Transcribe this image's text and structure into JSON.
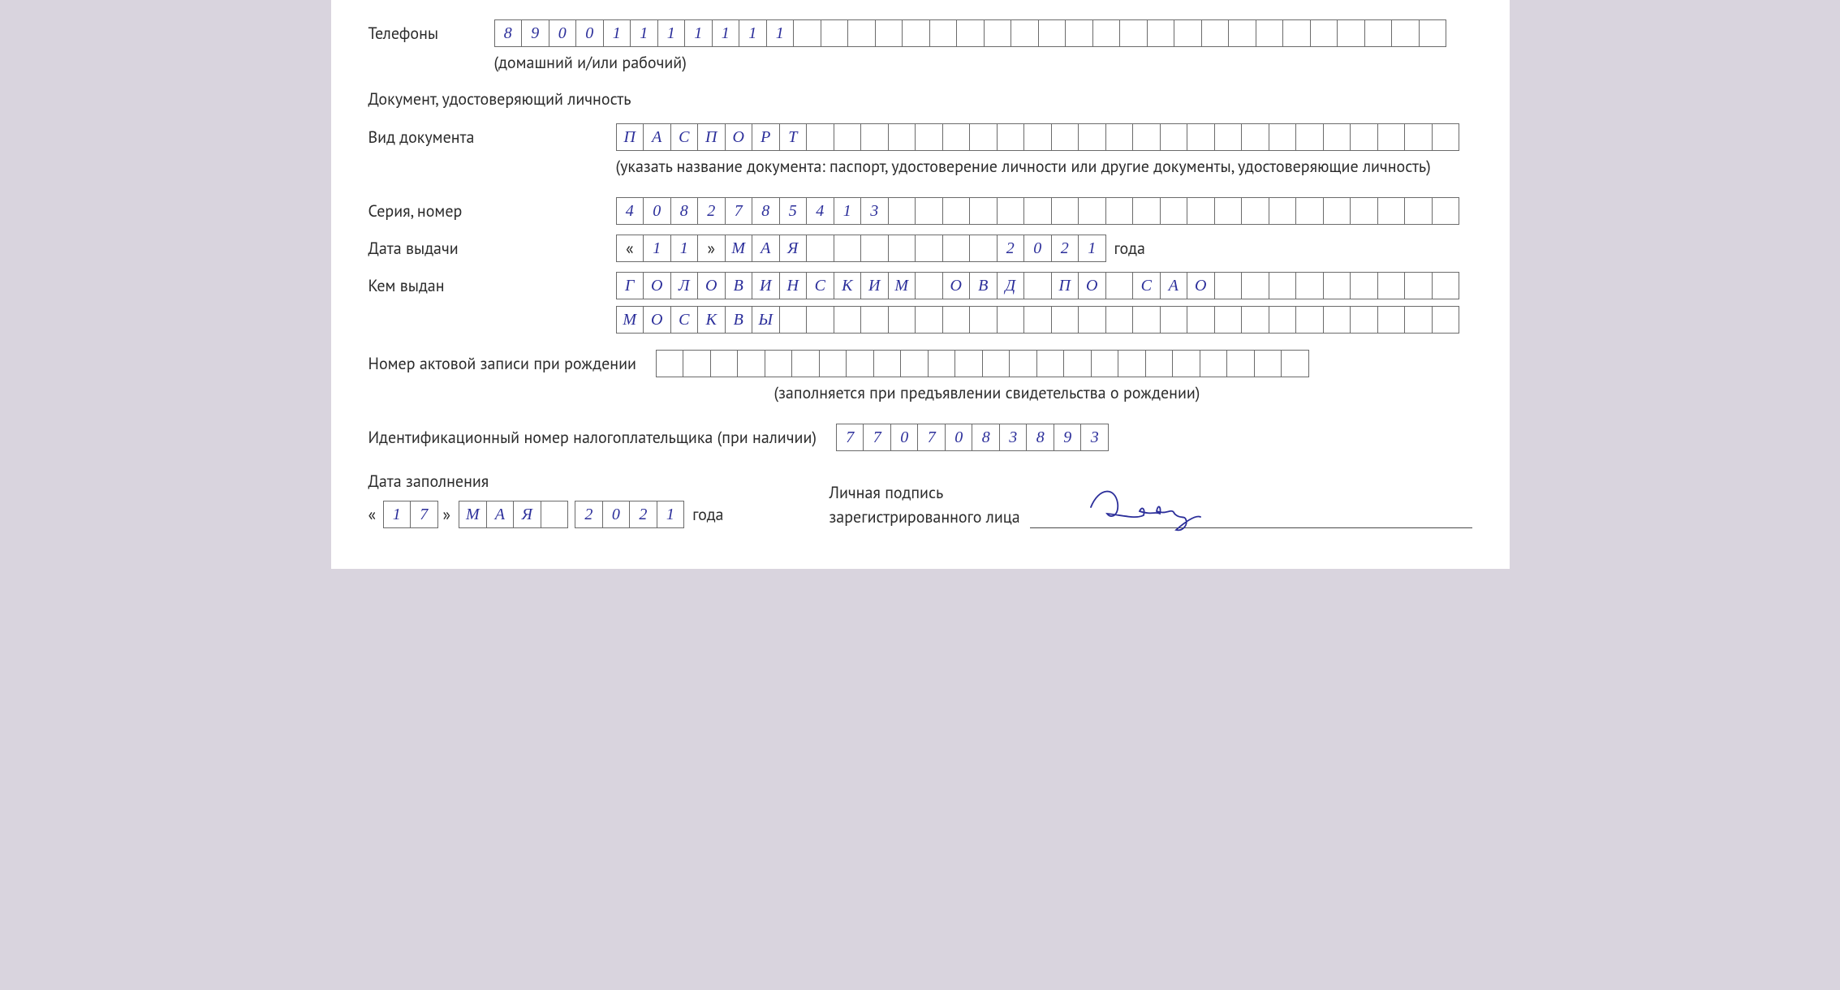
{
  "phone": {
    "label": "Телефоны",
    "cells": [
      "8",
      "9",
      "0",
      "0",
      "1",
      "1",
      "1",
      "1",
      "1",
      "1",
      "1",
      "",
      "",
      "",
      "",
      "",
      "",
      "",
      "",
      "",
      "",
      "",
      "",
      "",
      "",
      "",
      "",
      "",
      "",
      "",
      "",
      "",
      "",
      "",
      ""
    ],
    "hint": "(домашний и/или рабочий)"
  },
  "doc": {
    "header": "Документ, удостоверяющий личность",
    "type_label": "Вид документа",
    "type_cells": [
      "П",
      "А",
      "С",
      "П",
      "О",
      "Р",
      "Т",
      "",
      "",
      "",
      "",
      "",
      "",
      "",
      "",
      "",
      "",
      "",
      "",
      "",
      "",
      "",
      "",
      "",
      "",
      "",
      "",
      "",
      "",
      "",
      ""
    ],
    "type_hint": "(указать название документа: паспорт, удостоверение личности или другие документы, удостоверяющие личность)",
    "serial_label": "Серия, номер",
    "serial_cells": [
      "4",
      "0",
      "8",
      "2",
      "7",
      "8",
      "5",
      "4",
      "1",
      "3",
      "",
      "",
      "",
      "",
      "",
      "",
      "",
      "",
      "",
      "",
      "",
      "",
      "",
      "",
      "",
      "",
      "",
      "",
      "",
      "",
      ""
    ],
    "issue_label": "Дата выдачи",
    "issue_day": [
      "1",
      "1"
    ],
    "issue_month": [
      "М",
      "А",
      "Я",
      "",
      "",
      "",
      "",
      "",
      "",
      ""
    ],
    "issue_year": [
      "2",
      "0",
      "2",
      "1"
    ],
    "year_word": "года",
    "by_label": "Кем выдан",
    "by_line1": [
      "Г",
      "О",
      "Л",
      "О",
      "В",
      "И",
      "Н",
      "С",
      "К",
      "И",
      "М",
      "",
      "О",
      "В",
      "Д",
      "",
      "П",
      "О",
      "",
      "С",
      "А",
      "О",
      "",
      "",
      "",
      "",
      "",
      "",
      "",
      "",
      ""
    ],
    "by_line2": [
      "М",
      "О",
      "С",
      "К",
      "В",
      "Ы",
      "",
      "",
      "",
      "",
      "",
      "",
      "",
      "",
      "",
      "",
      "",
      "",
      "",
      "",
      "",
      "",
      "",
      "",
      "",
      "",
      "",
      "",
      "",
      "",
      ""
    ]
  },
  "birth": {
    "label": "Номер актовой записи при рождении",
    "cells": [
      "",
      "",
      "",
      "",
      "",
      "",
      "",
      "",
      "",
      "",
      "",
      "",
      "",
      "",
      "",
      "",
      "",
      "",
      "",
      "",
      "",
      "",
      "",
      ""
    ],
    "hint": "(заполняется при предъявлении свидетельства о рождении)"
  },
  "inn": {
    "label": "Идентификационный номер налогоплательщика (при наличии)",
    "cells": [
      "7",
      "7",
      "0",
      "7",
      "0",
      "8",
      "3",
      "8",
      "9",
      "3"
    ]
  },
  "fill_date": {
    "label": "Дата заполнения",
    "day": [
      "1",
      "7"
    ],
    "month": [
      "М",
      "А",
      "Я",
      ""
    ],
    "year": [
      "2",
      "0",
      "2",
      "1"
    ],
    "year_word": "года"
  },
  "signature": {
    "line1": "Личная подпись",
    "line2": "зарегистрированного лица"
  },
  "q_open": "«",
  "q_close": "»"
}
